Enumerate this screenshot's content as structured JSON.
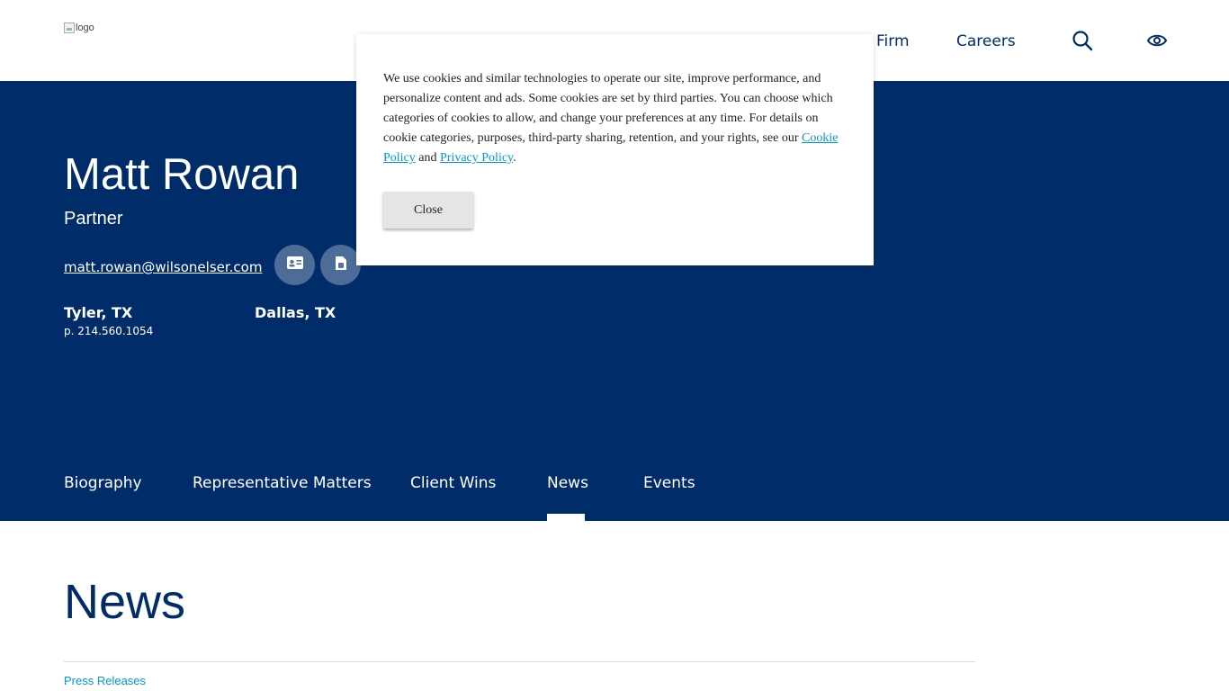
{
  "header": {
    "logo_alt": "logo",
    "nav": [
      {
        "label": "Firm"
      },
      {
        "label": "Careers"
      }
    ],
    "search_icon": "search-icon",
    "accessibility_icon": "eye-icon"
  },
  "profile": {
    "name": "Matt Rowan",
    "title": "Partner",
    "email": "matt.rowan@wilsonelser.com",
    "vcard_icon": "vcard-icon",
    "pdf_icon": "document-icon",
    "locations": [
      {
        "city": "Tyler, TX",
        "phone": "p. 214.560.1054"
      },
      {
        "city": "Dallas, TX"
      }
    ]
  },
  "tabs": [
    {
      "label": "Biography"
    },
    {
      "label": "Representative Matters"
    },
    {
      "label": "Client Wins"
    },
    {
      "label": "News",
      "active": true
    },
    {
      "label": "Events"
    }
  ],
  "main": {
    "section_title": "News",
    "category": "Press Releases"
  },
  "cookie_modal": {
    "text_before": "We use cookies and similar technologies to operate our site, improve performance, and personalize content and ads. Some cookies are set by third parties. You can choose which categories of cookies to allow, and change your preferences at any time. For details on cookie categories, purposes, third-party sharing, retention, and your rights, see our ",
    "cookie_link": "Cookie Policy",
    "and": " and ",
    "privacy_link": "Privacy Policy",
    "period": ".",
    "close_label": "Close"
  },
  "colors": {
    "brand_navy": "#002d6a",
    "link_blue": "#0099cc"
  }
}
